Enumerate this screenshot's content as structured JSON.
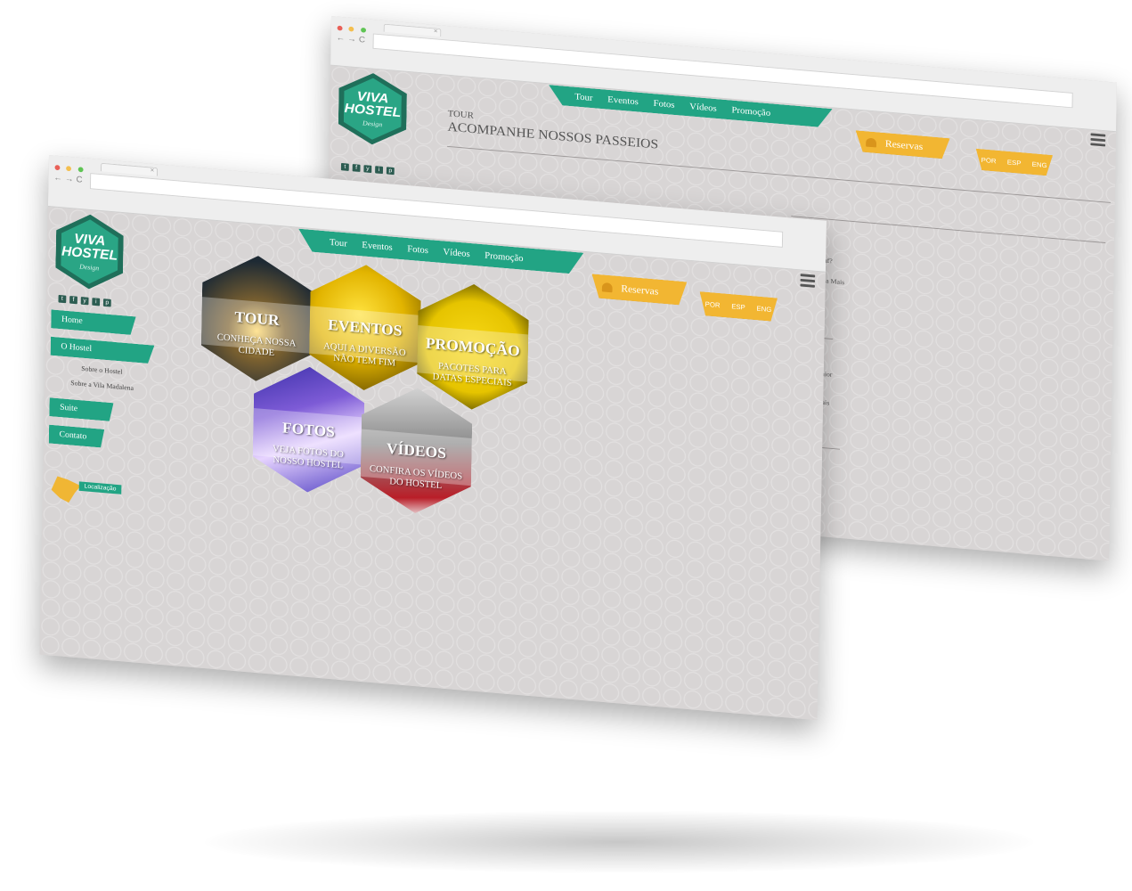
{
  "back_window": {
    "menu": [
      "Tour",
      "Eventos",
      "Fotos",
      "Vídeos",
      "Promoção"
    ],
    "reservas_label": "Reservas",
    "languages": [
      "POR",
      "ESP",
      "ENG"
    ],
    "logo": {
      "line1": "VIVA",
      "line2": "HOSTEL",
      "line3": "Design"
    },
    "section_kicker": "TOUR",
    "section_title": "ACOMPANHE NOSSOS PASSEIOS",
    "snippets": [
      "Maluf?",
      "Leia Mais",
      "osso maior",
      "Leia Mais"
    ]
  },
  "front_window": {
    "menu": [
      "Tour",
      "Eventos",
      "Fotos",
      "Vídeos",
      "Promoção"
    ],
    "reservas_label": "Reservas",
    "languages": [
      "POR",
      "ESP",
      "ENG"
    ],
    "logo": {
      "line1": "VIVA",
      "line2": "HOSTEL",
      "line3": "Design"
    },
    "sidebar": {
      "home": "Home",
      "hostel": "O Hostel",
      "sub1": "Sobre o Hostel",
      "sub2": "Sobre a Vila Madalena",
      "suite": "Suite",
      "contato": "Contato",
      "localizacao": "Localização"
    },
    "tiles": {
      "tour": {
        "title": "TOUR",
        "subtitle": "CONHEÇA NOSSA CIDADE"
      },
      "eventos": {
        "title": "EVENTOS",
        "subtitle": "AQUI A DIVERSÃO NÃO TEM FIM"
      },
      "promocao": {
        "title": "PROMOÇÃO",
        "subtitle": "PACOTES PARA DATAS ESPECIAIS"
      },
      "fotos": {
        "title": "FOTOS",
        "subtitle": "VEJA FOTOS DO NOSSO HOSTEL"
      },
      "videos": {
        "title": "VÍDEOS",
        "subtitle": "CONFIRA OS VÍDEOS DO HOSTEL"
      }
    }
  },
  "colors": {
    "teal": "#22a484",
    "yellow": "#f2b632",
    "background": "#d9d6d6"
  }
}
